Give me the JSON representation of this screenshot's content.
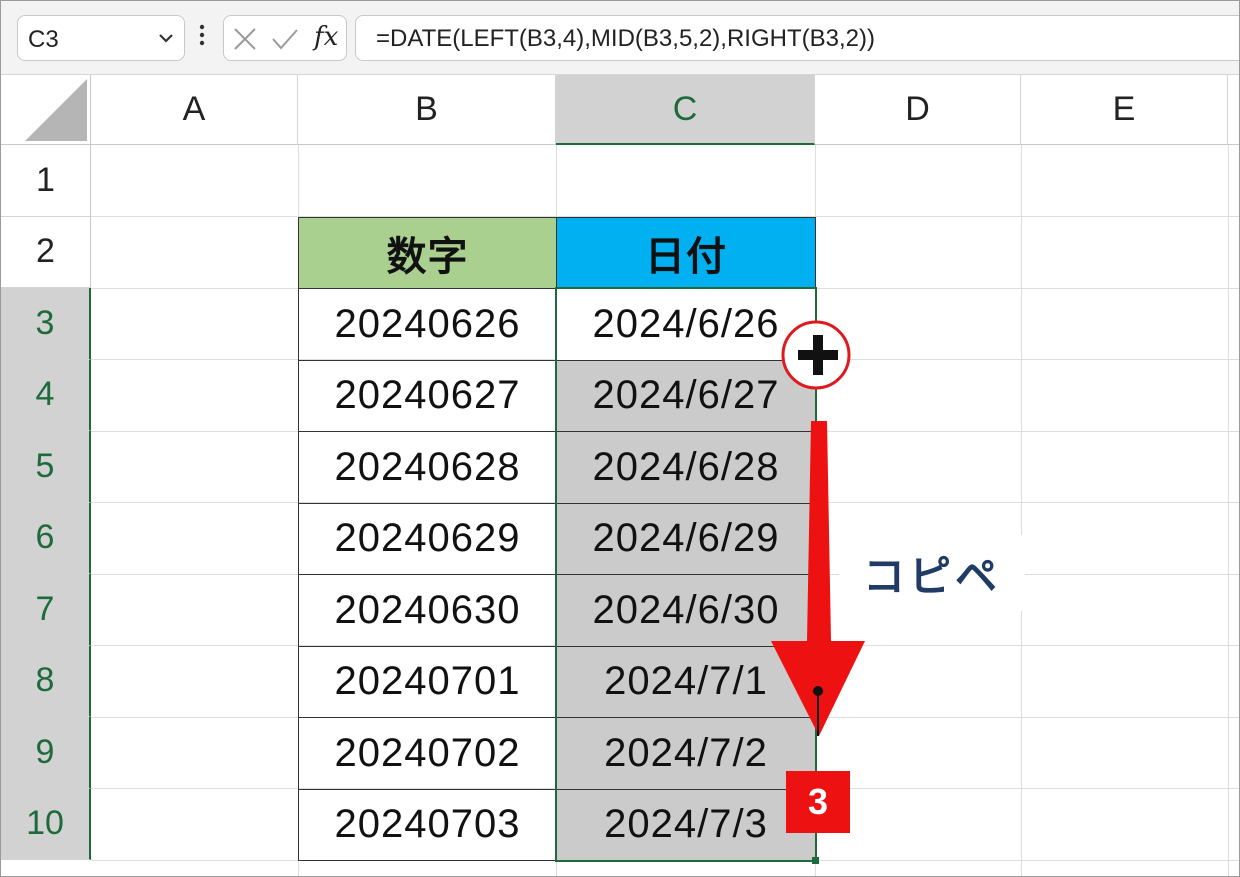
{
  "formula_bar": {
    "name_box": "C3",
    "fx_label": "fx",
    "formula": "=DATE(LEFT(B3,4),MID(B3,5,2),RIGHT(B3,2))"
  },
  "columns": [
    "A",
    "B",
    "C",
    "D",
    "E"
  ],
  "rows": [
    "1",
    "2",
    "3",
    "4",
    "5",
    "6",
    "7",
    "8",
    "9",
    "10"
  ],
  "table": {
    "header_number": "数字",
    "header_date": "日付",
    "header_number_color": "#a9d08e",
    "header_date_color": "#00b0f0",
    "numbers": [
      "20240626",
      "20240627",
      "20240628",
      "20240629",
      "20240630",
      "20240701",
      "20240702",
      "20240703"
    ],
    "dates": [
      "2024/6/26",
      "2024/6/27",
      "2024/6/28",
      "2024/6/29",
      "2024/6/30",
      "2024/7/1",
      "2024/7/2",
      "2024/7/3"
    ]
  },
  "annotation": {
    "copy_label": "コピペ",
    "step_number": "3",
    "arrow_color": "#ee1111",
    "circle_color": "#e0191f"
  },
  "selection": {
    "range": "C3:C10",
    "border_color": "#1d6b3a"
  }
}
